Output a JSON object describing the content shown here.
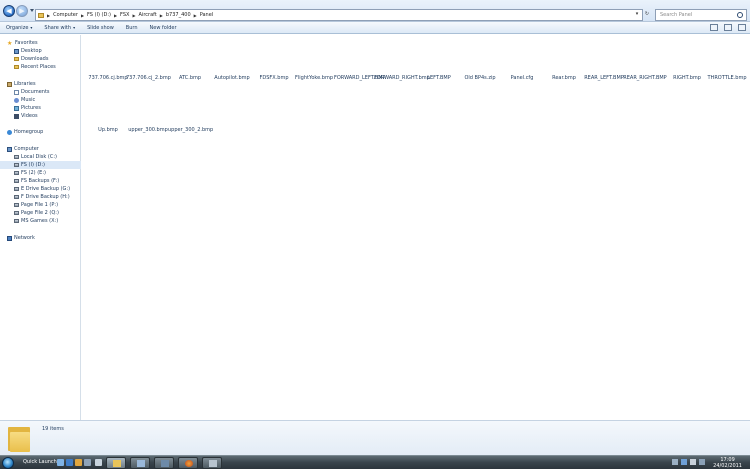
{
  "address_bar": {
    "crumbs": [
      "Computer",
      "FS (I) (D:)",
      "FSX",
      "Aircraft",
      "b737_400",
      "Panel"
    ],
    "search_placeholder": "Search Panel"
  },
  "toolbar": {
    "organize": "Organize",
    "share_with": "Share with",
    "slide_show": "Slide show",
    "burn": "Burn",
    "new_folder": "New folder"
  },
  "sidebar": {
    "favorites": "Favorites",
    "favorites_items": [
      "Desktop",
      "Downloads",
      "Recent Places"
    ],
    "libraries": "Libraries",
    "libraries_items": [
      "Documents",
      "Music",
      "Pictures",
      "Videos"
    ],
    "homegroup": "Homegroup",
    "computer": "Computer",
    "computer_items": [
      "Local Disk (C:)",
      "FS (I) (D:)",
      "FS (2) (E:)",
      "FS Backups (F:)",
      "E Drive Backup (G:)",
      "F Drive Backup (H:)",
      "Page File 1 (P:)",
      "Page File 2 (Q:)",
      "MS Games (X:)"
    ],
    "selected_item": "FS (I) (D:)",
    "network": "Network"
  },
  "files": [
    "737.706.cj.bmp",
    "737.706.cj_2.bmp",
    "ATC.bmp",
    "Autopilot.bmp",
    "FDSFX.bmp",
    "FlightYoke.bmp",
    "FORWARD_LEFT.BMP",
    "FORWARD_RIGHT.bmp",
    "LEFT.BMP",
    "Old BP4s.zip",
    "Panel.cfg",
    "Rear.bmp",
    "REAR_LEFT.BMP",
    "REAR_RIGHT.BMP",
    "RIGHT.bmp",
    "THROTTLE.bmp",
    "Up.bmp",
    "upper_300.bmp",
    "upper_300_2.bmp"
  ],
  "details": {
    "item_count": "19 items"
  },
  "taskbar": {
    "quick_launch": "Quick Launch",
    "time": "17:09",
    "date": "24/02/2011"
  }
}
